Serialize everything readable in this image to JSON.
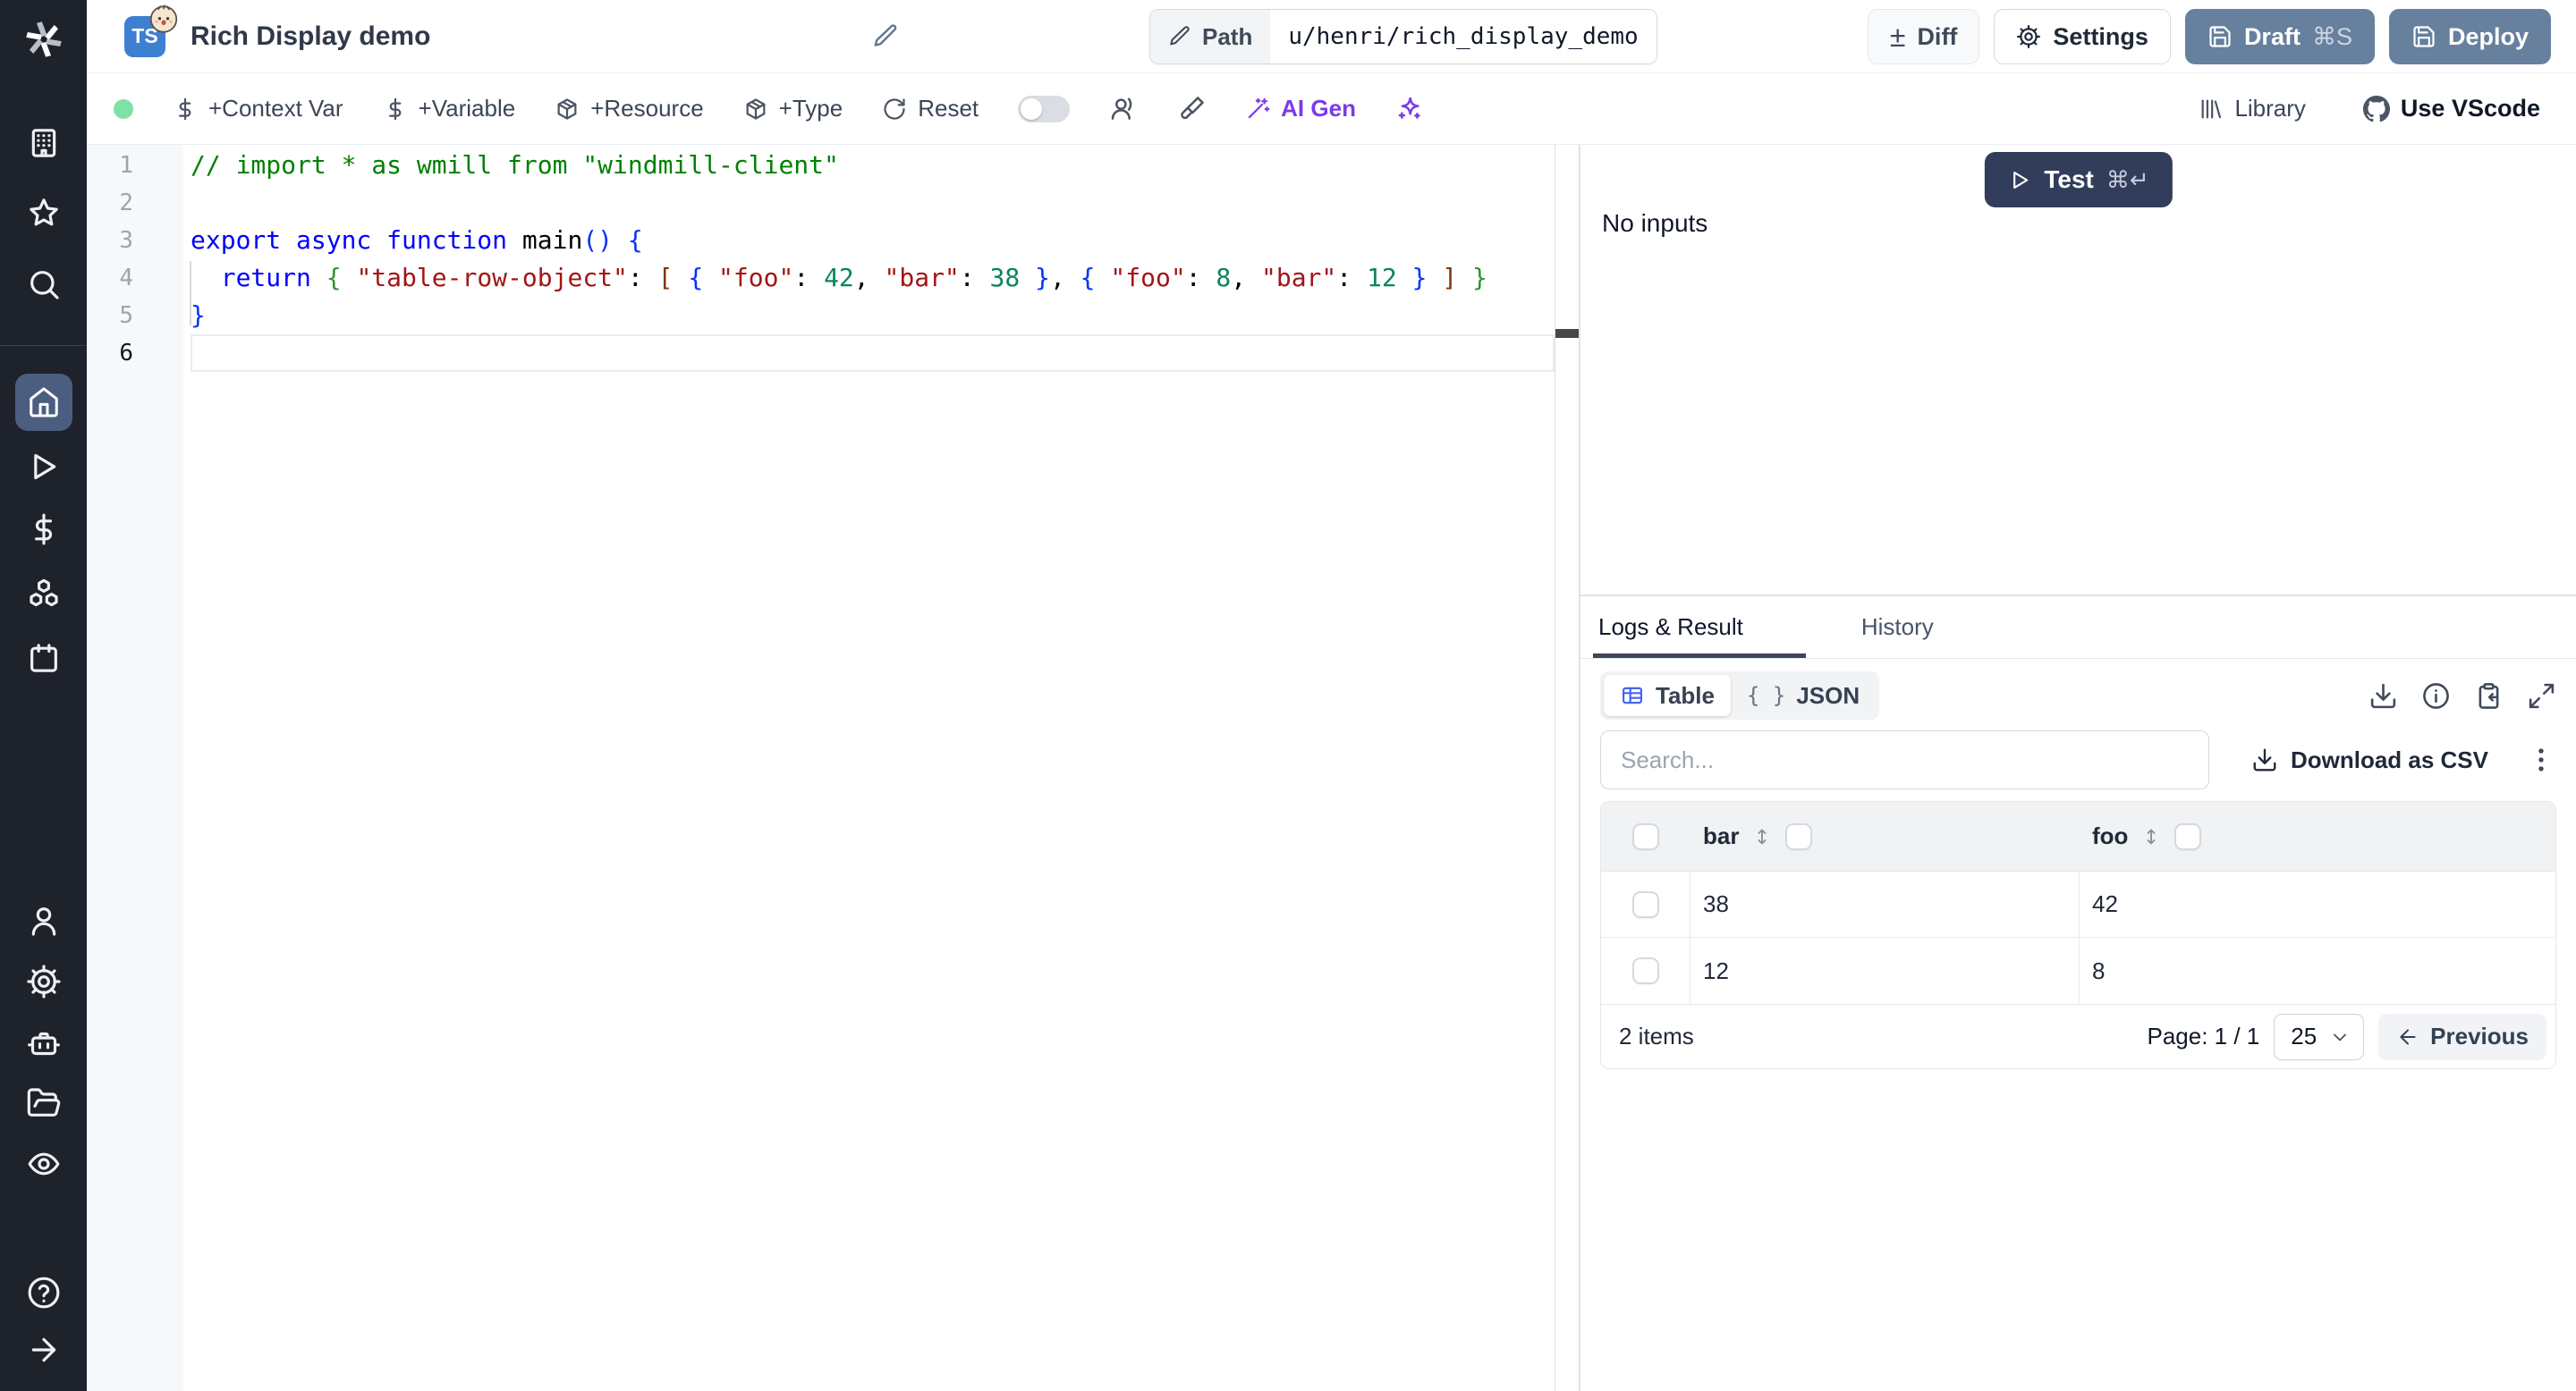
{
  "header": {
    "badge": "TS",
    "title": "Rich Display demo",
    "path_label": "Path",
    "path_value": "u/henri/rich_display_demo",
    "diff": "Diff",
    "settings": "Settings",
    "draft": "Draft",
    "draft_shortcut": "⌘S",
    "deploy": "Deploy"
  },
  "toolbar": {
    "context_var": "+Context Var",
    "variable": "+Variable",
    "resource": "+Resource",
    "type": "+Type",
    "reset": "Reset",
    "ai_gen": "AI Gen",
    "library": "Library",
    "vscode": "Use VScode"
  },
  "editor": {
    "active_line": 6,
    "lines": [
      {
        "n": 1,
        "tokens": [
          {
            "t": "// import * as wmill from \"windmill-client\"",
            "c": "comment"
          }
        ]
      },
      {
        "n": 2,
        "tokens": []
      },
      {
        "n": 3,
        "tokens": [
          {
            "t": "export async function",
            "c": "kw"
          },
          {
            "t": " main",
            "c": "plain"
          },
          {
            "t": "()",
            "c": "b1"
          },
          {
            "t": " ",
            "c": "plain"
          },
          {
            "t": "{",
            "c": "b1"
          }
        ]
      },
      {
        "n": 4,
        "tokens": [
          {
            "t": "  ",
            "c": "plain"
          },
          {
            "t": "return",
            "c": "kw"
          },
          {
            "t": " ",
            "c": "plain"
          },
          {
            "t": "{",
            "c": "b2"
          },
          {
            "t": " ",
            "c": "plain"
          },
          {
            "t": "\"table-row-object\"",
            "c": "str"
          },
          {
            "t": ": ",
            "c": "plain"
          },
          {
            "t": "[",
            "c": "b3"
          },
          {
            "t": " ",
            "c": "plain"
          },
          {
            "t": "{",
            "c": "b1"
          },
          {
            "t": " ",
            "c": "plain"
          },
          {
            "t": "\"foo\"",
            "c": "str"
          },
          {
            "t": ": ",
            "c": "plain"
          },
          {
            "t": "42",
            "c": "num"
          },
          {
            "t": ", ",
            "c": "plain"
          },
          {
            "t": "\"bar\"",
            "c": "str"
          },
          {
            "t": ": ",
            "c": "plain"
          },
          {
            "t": "38",
            "c": "num"
          },
          {
            "t": " ",
            "c": "plain"
          },
          {
            "t": "}",
            "c": "b1"
          },
          {
            "t": ", ",
            "c": "plain"
          },
          {
            "t": "{",
            "c": "b1"
          },
          {
            "t": " ",
            "c": "plain"
          },
          {
            "t": "\"foo\"",
            "c": "str"
          },
          {
            "t": ": ",
            "c": "plain"
          },
          {
            "t": "8",
            "c": "num"
          },
          {
            "t": ", ",
            "c": "plain"
          },
          {
            "t": "\"bar\"",
            "c": "str"
          },
          {
            "t": ": ",
            "c": "plain"
          },
          {
            "t": "12",
            "c": "num"
          },
          {
            "t": " ",
            "c": "plain"
          },
          {
            "t": "}",
            "c": "b1"
          },
          {
            "t": " ",
            "c": "plain"
          },
          {
            "t": "]",
            "c": "b3"
          },
          {
            "t": " ",
            "c": "plain"
          },
          {
            "t": "}",
            "c": "b2"
          }
        ]
      },
      {
        "n": 5,
        "tokens": [
          {
            "t": "}",
            "c": "b1"
          }
        ]
      },
      {
        "n": 6,
        "tokens": []
      }
    ]
  },
  "run_panel": {
    "test": "Test",
    "shortcut": "⌘↵",
    "no_inputs": "No inputs"
  },
  "result_panel": {
    "tabs": {
      "logs": "Logs & Result",
      "history": "History"
    },
    "view": {
      "table": "Table",
      "json": "JSON",
      "json_glyph": "{ }"
    },
    "search_placeholder": "Search...",
    "download_csv": "Download as CSV",
    "table": {
      "columns": [
        "bar",
        "foo"
      ],
      "rows": [
        {
          "bar": "38",
          "foo": "42"
        },
        {
          "bar": "12",
          "foo": "8"
        }
      ]
    },
    "footer": {
      "count": "2 items",
      "page": "Page: 1 / 1",
      "page_size": "25",
      "previous": "Previous"
    }
  },
  "colors": {
    "sidebar_bg": "#1e222b",
    "sidebar_active": "#4b5e80",
    "test_button": "#323d5b",
    "draft_deploy_button": "#66809e",
    "ai_purple": "#7c3aed",
    "ts_badge_blue": "#3d7fd0",
    "status_green": "#7ee2a8",
    "table_icon_blue": "#4565f0"
  },
  "icons": {
    "windmill-logo": "pinwheel blades",
    "building-icon": "workspace",
    "star-icon": "favorites",
    "search-icon": "magnifier",
    "home-icon": "home (active)",
    "runs-icon": "play triangle",
    "variables-icon": "dollar sign",
    "resources-icon": "boxes",
    "schedules-icon": "calendar",
    "user-icon": "person",
    "settings-gear-icon": "gear",
    "workers-icon": "robot",
    "folders-icon": "open folder",
    "audit-icon": "eye",
    "help-icon": "question circle",
    "expand-sidebar-icon": "arrow right",
    "pencil-icon": "edit",
    "diff-icon": "plus-minus",
    "save-icon": "floppy disk",
    "reset-icon": "rotate clockwise",
    "toggle": "switch off",
    "users-icon": "people",
    "format-icon": "paintbrush",
    "wand-icon": "magic wand",
    "sparkles-icon": "four point star",
    "library-icon": "books",
    "github-icon": "octocat",
    "play-icon": "outline triangle",
    "table-icon": "grid",
    "download-icon": "arrow into tray",
    "info-icon": "circle i",
    "copy-icon": "clipboard arrow",
    "expand-icon": "diagonal arrows",
    "kebab-icon": "three dots",
    "sort-icon": "up down arrows",
    "chevron-down-icon": "v",
    "arrow-left-icon": "back arrow"
  }
}
